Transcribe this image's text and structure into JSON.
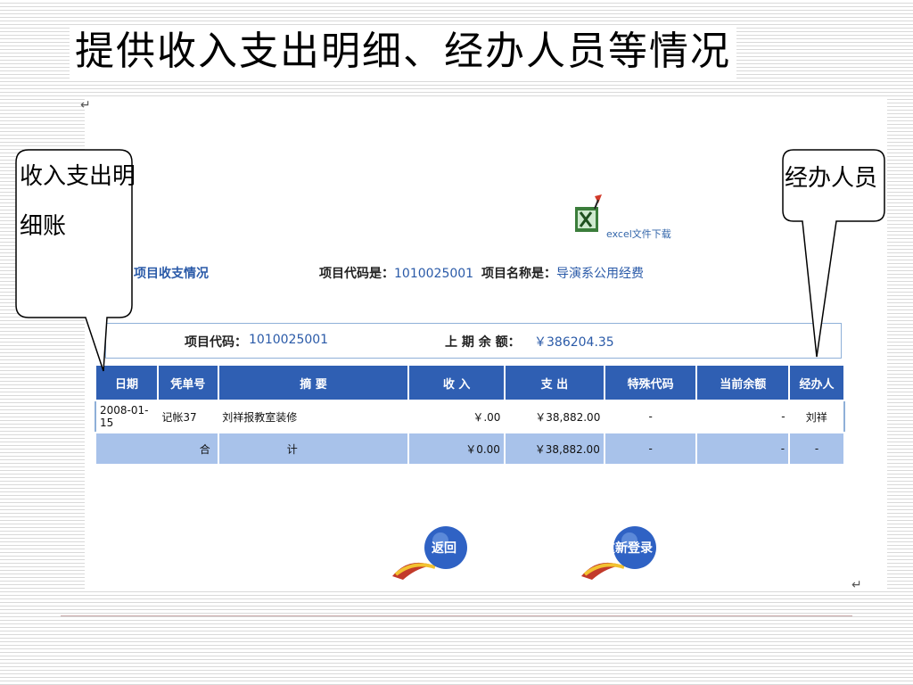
{
  "slide": {
    "title": "提供收入支出明细、经办人员等情况",
    "callout_left_line1": "收入支出明",
    "callout_left_line2": "细账",
    "callout_right": "经办人员",
    "para_mark": "↵"
  },
  "page": {
    "excel_label": "excel文件下载",
    "project_title": "项目收支情况",
    "code_label": "项目代码是：",
    "code_value": "1010025001",
    "name_label": "项目名称是：",
    "name_value": "导演系公用经费",
    "summary_code_label": "项目代码：",
    "summary_code_value": "1010025001",
    "balance_label": "上  期  余  额：",
    "balance_value": "￥386204.35"
  },
  "table": {
    "headers": [
      "日期",
      "凭单号",
      "摘      要",
      "收    入",
      "支    出",
      "特殊代码",
      "当前余额",
      "经办人"
    ],
    "rows": [
      [
        "2008-01-15",
        "记帐37",
        "刘祥报教室装修",
        "￥.00",
        "￥38,882.00",
        "-",
        "-",
        "刘祥"
      ]
    ],
    "total": [
      "合",
      "计",
      "￥0.00",
      "￥38,882.00",
      "-",
      "-",
      "-"
    ]
  },
  "buttons": {
    "back": "返回",
    "relogin": "重新登录"
  },
  "colors": {
    "header_bg": "#2f5fb3",
    "total_bg": "#a8c2ea",
    "link": "#2a5aa8",
    "button_blue": "#2f62c4"
  }
}
